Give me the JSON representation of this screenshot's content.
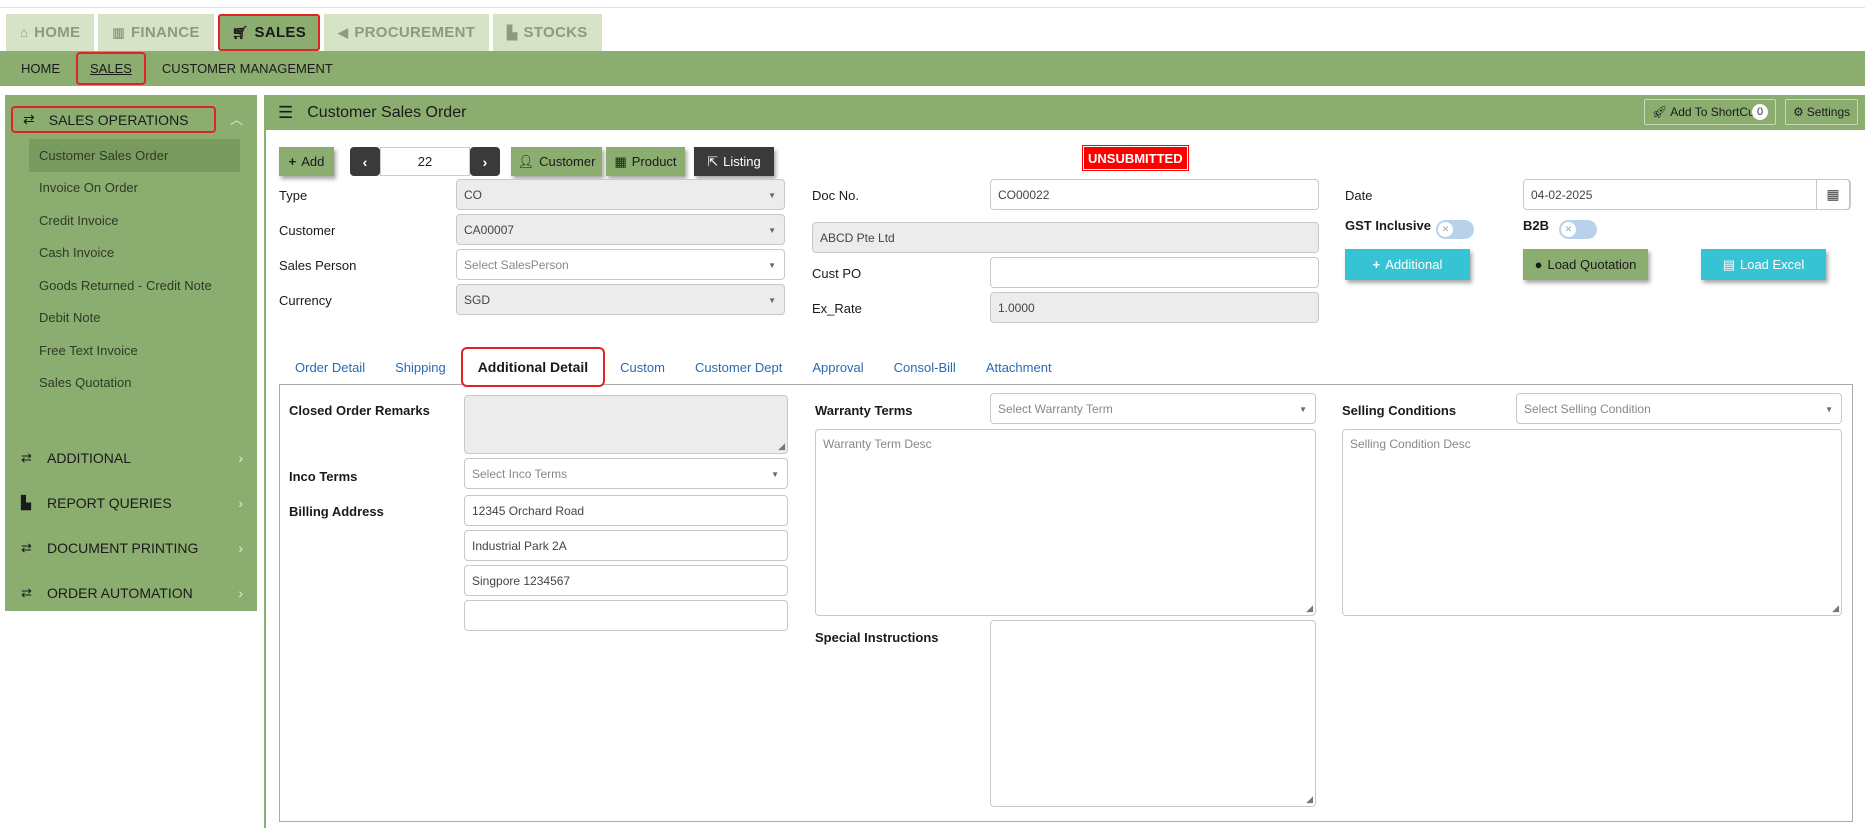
{
  "module_tabs": [
    {
      "icon": "home-icon",
      "glyph": "⌂",
      "label": "HOME"
    },
    {
      "icon": "bank-icon",
      "glyph": "🏛",
      "label": "FINANCE"
    },
    {
      "icon": "cart-icon",
      "glyph": "🛒",
      "label": "SALES"
    },
    {
      "icon": "megaphone-icon",
      "glyph": "📢",
      "label": "PROCUREMENT"
    },
    {
      "icon": "bar-chart-icon",
      "glyph": "📊",
      "label": "STOCKS"
    }
  ],
  "sub_menu": [
    "HOME",
    "SALES",
    "CUSTOMER MANAGEMENT"
  ],
  "sidebar": {
    "header": "SALES OPERATIONS",
    "items": [
      "Customer Sales Order",
      "Invoice On Order",
      "Credit Invoice",
      "Cash Invoice",
      "Goods Returned - Credit Note",
      "Debit Note",
      "Free Text Invoice",
      "Sales Quotation"
    ],
    "groups": [
      {
        "icon": "swap-icon",
        "label": "ADDITIONAL"
      },
      {
        "icon": "report-icon",
        "label": "REPORT QUERIES"
      },
      {
        "icon": "swap-icon",
        "label": "DOCUMENT PRINTING"
      },
      {
        "icon": "swap-icon",
        "label": "ORDER AUTOMATION"
      }
    ]
  },
  "panel": {
    "title": "Customer Sales Order",
    "shortcut_label": "Add To ShortCut",
    "shortcut_count": "0",
    "settings_label": "Settings"
  },
  "toolbar": {
    "add_label": "Add",
    "record_number": "22",
    "customer_label": "Customer",
    "product_label": "Product",
    "listing_label": "Listing",
    "status": "UNSUBMITTED"
  },
  "form": {
    "type_label": "Type",
    "type_value": "CO",
    "customer_label": "Customer",
    "customer_value": "CA00007",
    "salesperson_label": "Sales Person",
    "salesperson_placeholder": "Select SalesPerson",
    "currency_label": "Currency",
    "currency_value": "SGD",
    "docno_label": "Doc No.",
    "docno_value": "CO00022",
    "customer_name": "ABCD Pte Ltd",
    "custpo_label": "Cust PO",
    "custpo_value": "",
    "exrate_label": "Ex_Rate",
    "exrate_value": "1.0000",
    "date_label": "Date",
    "date_value": "04-02-2025",
    "gst_label": "GST Inclusive",
    "b2b_label": "B2B",
    "additional_btn": "Additional",
    "load_quotation_btn": "Load Quotation",
    "load_excel_btn": "Load Excel"
  },
  "detail_tabs": [
    "Order Detail",
    "Shipping",
    "Additional Detail",
    "Custom",
    "Customer Dept",
    "Approval",
    "Consol-Bill",
    "Attachment"
  ],
  "additional_detail": {
    "closed_remarks_label": "Closed Order Remarks",
    "inco_label": "Inco Terms",
    "inco_placeholder": "Select Inco Terms",
    "billing_label": "Billing Address",
    "billing_lines": [
      "12345 Orchard Road",
      "Industrial Park 2A",
      "Singpore 1234567",
      ""
    ],
    "warranty_label": "Warranty Terms",
    "warranty_placeholder": "Select Warranty Term",
    "warranty_desc_placeholder": "Warranty Term Desc",
    "special_label": "Special Instructions",
    "selling_label": "Selling Conditions",
    "selling_placeholder": "Select Selling Condition",
    "selling_desc_placeholder": "Selling Condition Desc"
  }
}
